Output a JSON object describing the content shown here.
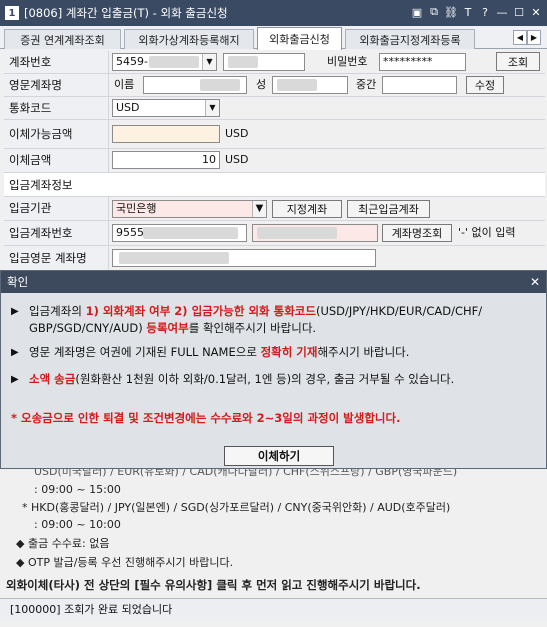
{
  "window": {
    "number": "1",
    "title": "[0806] 계좌간 입출금(T) - 외화 출금신청"
  },
  "tabs": [
    "증권 연계계좌조회",
    "외화가상계좌등록해지",
    "외화출금신청",
    "외화출금지정계좌등록"
  ],
  "form": {
    "account_label": "계좌번호",
    "account_value": "5459-",
    "password_label": "비밀번호",
    "password_value": "*********",
    "lookup_button": "조회",
    "english_name_label": "영문계좌명",
    "first_name_label": "이름",
    "last_name_label": "성",
    "middle_name_label": "중간",
    "edit_button": "수정",
    "currency_label": "통화코드",
    "currency_value": "USD",
    "available_label": "이체가능금액",
    "available_unit": "USD",
    "amount_label": "이체금액",
    "amount_value": "10",
    "amount_unit": "USD",
    "deposit_section": "입금계좌정보",
    "bank_label": "입금기관",
    "bank_value": "국민은행",
    "designated_button": "지정계좌",
    "recent_button": "최근입금계좌",
    "deposit_account_label": "입금계좌번호",
    "deposit_account_value": "9555",
    "account_name_button": "계좌명조회",
    "dash_hint": "'-' 없이 입력",
    "deposit_english_label": "입금영문 계좌명"
  },
  "info": {
    "line1": "USD(미국달러) / EUR(유로화) / CAD(캐나다달러) / CHF(스위스프랑) / GBP(영국파운드)",
    "line2": ": 09:00 ~ 15:00",
    "line3": "* HKD(홍콩달러) / JPY(일본엔) / SGD(싱가포르달러) / CNY(중국위안화) / AUD(호주달러)",
    "line4": ": 09:00 ~ 10:00",
    "line5": "◆ 출금 수수료: 없음",
    "line6": "◆ OTP 발급/등록 우선 진행해주시기 바랍니다.",
    "line7": "외화이체(타사) 전 상단의 [필수 유의사항] 클릭 후 먼저 읽고 진행해주시기 바랍니다."
  },
  "status": "[100000] 조회가 완료 되었습니다",
  "dialog": {
    "title": "확인",
    "b1_pre": "입금계좌의 ",
    "b1_red1": "1) 외화계좌 여부 2) 입금가능한 외화 통화코드",
    "b1_mid": "(USD/JPY/HKD/EUR/CAD/CHF/",
    "b1_line2_pre": "GBP/SGD/CNY/AUD) ",
    "b1_red2": "등록여부",
    "b1_post": "를 확인해주시기 바랍니다.",
    "b2_pre": "영문 계좌명은 여권에 기재된 FULL NAME으로 ",
    "b2_red": "정확히 기재",
    "b2_post": "해주시기 바랍니다.",
    "b3_red": "소액 송금",
    "b3_post": "(원화환산 1천원 이하 외화/0.1달러, 1엔 등)의 경우, 출금 거부될 수 있습니다.",
    "warning": "* 오송금으로 인한 퇴결 및 조건변경에는 수수료와 2~3일의 과정이 발생합니다.",
    "button": "이체하기"
  }
}
